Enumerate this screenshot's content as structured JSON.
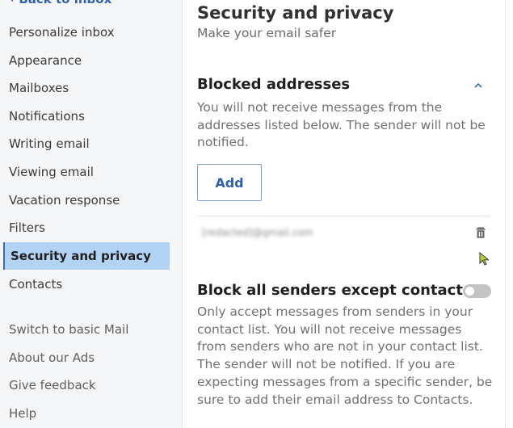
{
  "sidebar": {
    "back_label": "Back to inbox",
    "items": [
      {
        "label": "Personalize inbox"
      },
      {
        "label": "Appearance"
      },
      {
        "label": "Mailboxes"
      },
      {
        "label": "Notifications"
      },
      {
        "label": "Writing email"
      },
      {
        "label": "Viewing email"
      },
      {
        "label": "Vacation response"
      },
      {
        "label": "Filters"
      },
      {
        "label": "Security and privacy",
        "selected": true
      },
      {
        "label": "Contacts"
      }
    ],
    "footer_items": [
      {
        "label": "Switch to basic Mail"
      },
      {
        "label": "About our Ads"
      },
      {
        "label": "Give feedback"
      },
      {
        "label": "Help"
      }
    ]
  },
  "main": {
    "title": "Security and privacy",
    "subtitle": "Make your email safer",
    "blocked": {
      "title": "Blocked addresses",
      "description": "You will not receive messages from the addresses listed below. The sender will not be notified.",
      "add_label": "Add",
      "addresses": [
        {
          "email": "[redacted]@gmail.com"
        }
      ],
      "expanded": true
    },
    "block_all": {
      "title": "Block all senders except contacts",
      "enabled": false,
      "description": "Only accept messages from senders in your contact list. You will not receive messages from senders who are not in your contact list. The sender will not be notified. If you are expecting messages from a specific sender, be sure to add their email address to Contacts."
    }
  },
  "colors": {
    "accent": "#2f62a8",
    "selected_bg": "#b3d3f5",
    "sidebar_bg": "#f5f6f7",
    "toggle_off": "#c3c3c3"
  }
}
